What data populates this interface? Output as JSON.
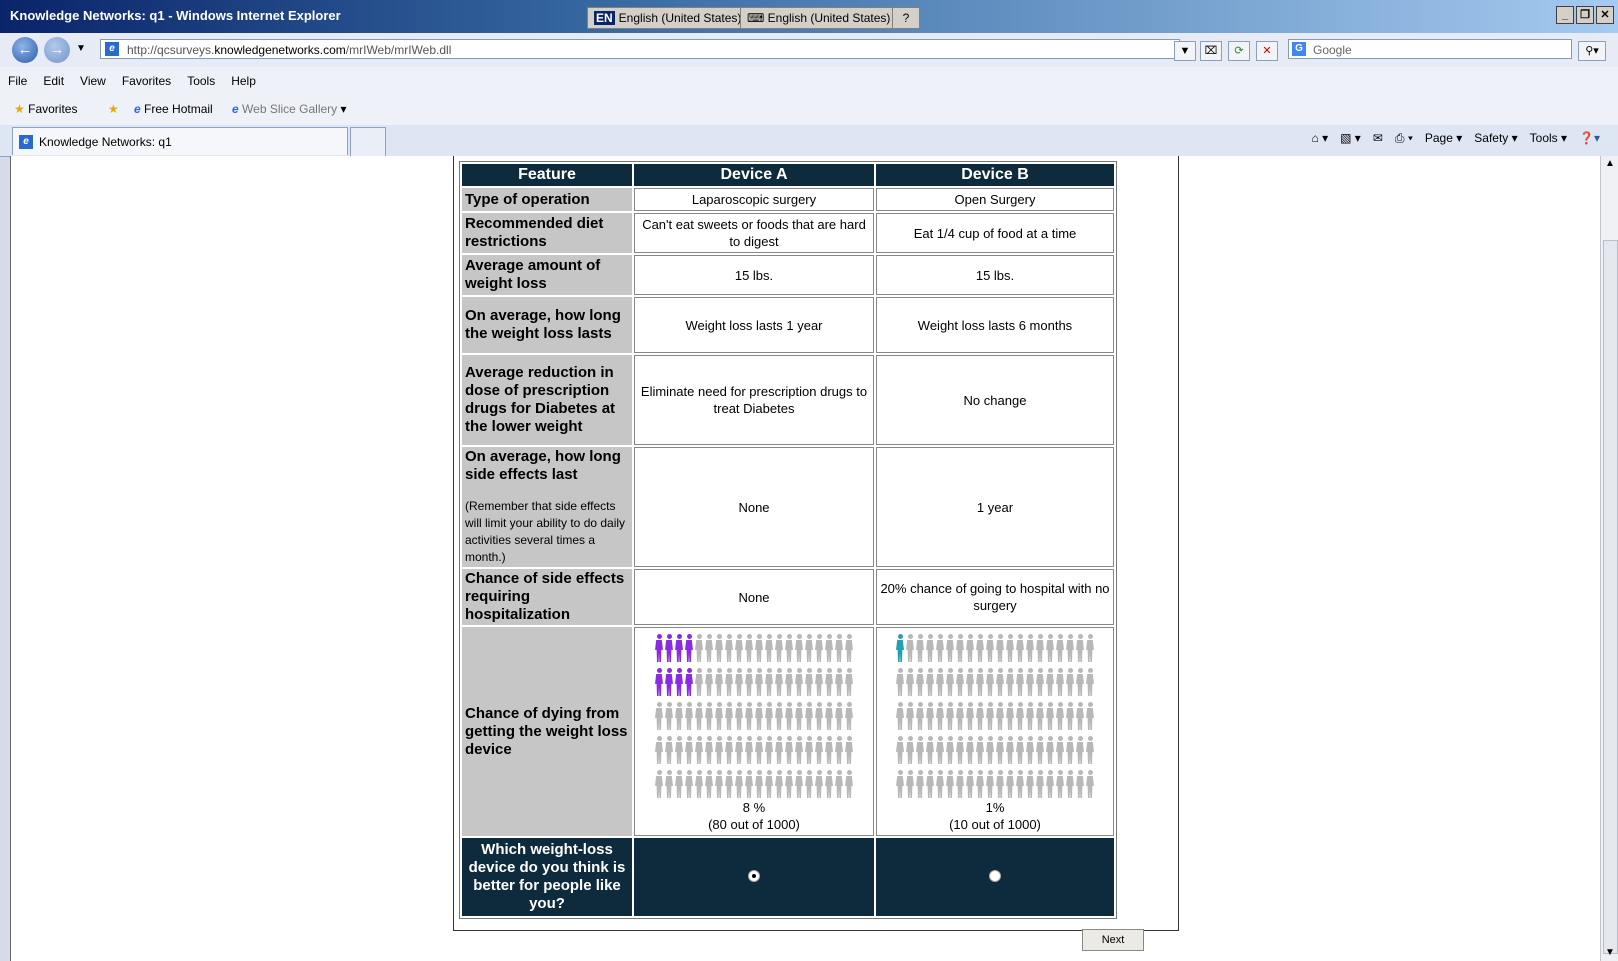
{
  "window": {
    "title": "Knowledge Networks: q1 - Windows Internet Explorer",
    "lang1": "English (United States)",
    "lang1_code": "EN",
    "lang2": "English (United States)",
    "help": "?"
  },
  "address": {
    "url_prefix": "http://qcsurveys.",
    "url_domain": "knowledgenetworks.com",
    "url_suffix": "/mrIWeb/mrIWeb.dll",
    "search_placeholder": "Google"
  },
  "menu": [
    "File",
    "Edit",
    "View",
    "Favorites",
    "Tools",
    "Help"
  ],
  "favorites": {
    "label": "Favorites",
    "items": [
      "Free Hotmail",
      "Web Slice Gallery"
    ]
  },
  "tab": {
    "title": "Knowledge Networks: q1"
  },
  "commandbar": [
    "Page",
    "Safety",
    "Tools"
  ],
  "survey": {
    "headers": [
      "Feature",
      "Device A",
      "Device B"
    ],
    "rows": [
      {
        "label": "Type of operation",
        "a": "Laparoscopic surgery",
        "b": "Open Surgery"
      },
      {
        "label": "Recommended diet restrictions",
        "a": "Can't eat sweets or foods that are hard to digest",
        "b": "Eat 1/4 cup of food at a time"
      },
      {
        "label": "Average amount of weight loss",
        "a": "15 lbs.",
        "b": "15 lbs."
      },
      {
        "label": "On average, how long the weight loss lasts",
        "a": "Weight loss lasts 1 year",
        "b": "Weight loss lasts 6 months"
      },
      {
        "label": "Average reduction in dose of prescription drugs for Diabetes at the lower weight",
        "a": "Eliminate need for prescription drugs to treat Diabetes",
        "b": "No change"
      },
      {
        "label": "On average, how long side effects last",
        "note": "(Remember that side effects will limit your ability to do daily activities several times a month.)",
        "a": "None",
        "b": "1 year"
      },
      {
        "label": "Chance of side effects requiring hospitalization",
        "a": "None",
        "b": "20% chance of going to hospital with no surgery"
      }
    ],
    "dying": {
      "label": "Chance of dying from getting the weight loss device",
      "a_pct": "8 %",
      "a_detail": "(80 out of 1000)",
      "b_pct": "1%",
      "b_detail": "(10 out of 1000)",
      "a_highlight": 8,
      "b_highlight": 1,
      "per_row": 20,
      "rows": 5,
      "a_color": "#8a2be2",
      "b_color": "#20a0b0",
      "base_color": "#b8b8b8"
    },
    "question": "Which weight-loss device do you think is better for people like you?",
    "selected": "A",
    "next_label": "Next"
  }
}
